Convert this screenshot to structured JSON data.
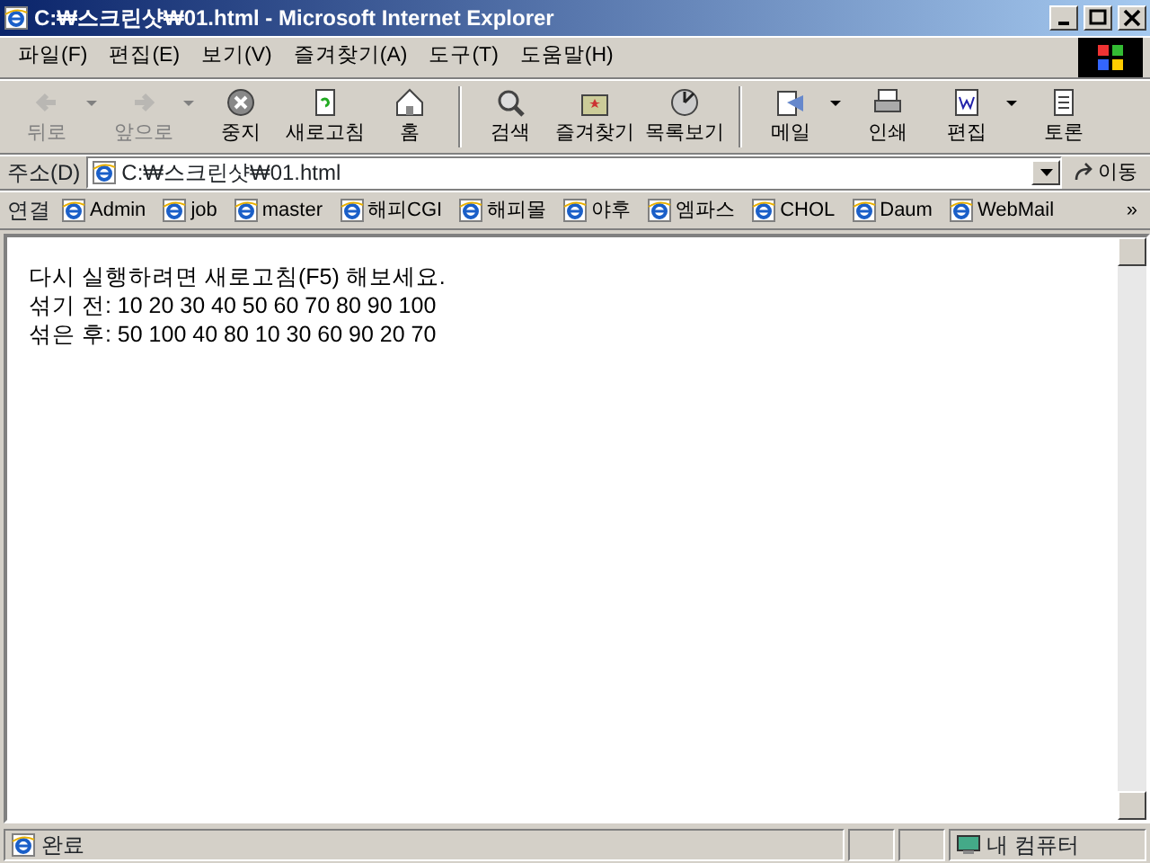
{
  "window": {
    "title": "C:₩스크린샷₩01.html - Microsoft Internet Explorer"
  },
  "menu": [
    "파일(F)",
    "편집(E)",
    "보기(V)",
    "즐겨찾기(A)",
    "도구(T)",
    "도움말(H)"
  ],
  "toolbar": [
    [
      {
        "label": "뒤로",
        "disabled": true,
        "dropdown": true
      },
      {
        "label": "앞으로",
        "disabled": true,
        "dropdown": true
      },
      {
        "label": "중지",
        "disabled": false,
        "dropdown": false
      },
      {
        "label": "새로고침",
        "disabled": false,
        "dropdown": false
      },
      {
        "label": "홈",
        "disabled": false,
        "dropdown": false
      }
    ],
    [
      {
        "label": "검색",
        "disabled": false,
        "dropdown": false
      },
      {
        "label": "즐겨찾기",
        "disabled": false,
        "dropdown": false
      },
      {
        "label": "목록보기",
        "disabled": false,
        "dropdown": false
      }
    ],
    [
      {
        "label": "메일",
        "disabled": false,
        "dropdown": true
      },
      {
        "label": "인쇄",
        "disabled": false,
        "dropdown": false
      },
      {
        "label": "편집",
        "disabled": false,
        "dropdown": true
      },
      {
        "label": "토론",
        "disabled": false,
        "dropdown": false
      }
    ]
  ],
  "address": {
    "label": "주소(D)",
    "value": "C:₩스크린샷₩01.html",
    "go": "이동"
  },
  "links": {
    "label": "연결",
    "items": [
      "Admin",
      "job",
      "master",
      "해피CGI",
      "해피몰",
      "야후",
      "엠파스",
      "CHOL",
      "Daum",
      "WebMail"
    ],
    "more": "»"
  },
  "content": [
    "다시 실행하려면 새로고침(F5) 해보세요.",
    "섞기 전: 10 20 30 40 50 60 70 80 90 100",
    "섞은 후: 50 100 40 80 10 30 60 90 20 70"
  ],
  "status_bar": {
    "text": "완료",
    "zone": "내 컴퓨터"
  }
}
